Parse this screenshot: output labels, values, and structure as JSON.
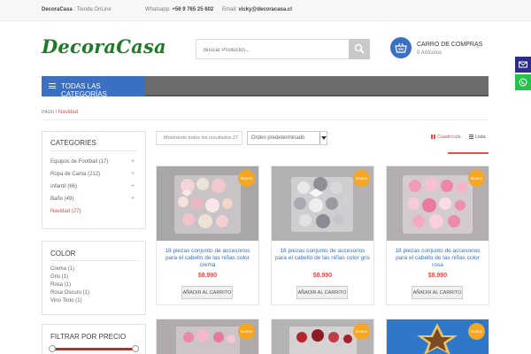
{
  "topbar": {
    "store_name": "DecoraCasa",
    "store_suffix": " : Tienda OnLine",
    "whatsapp_label": "Whatsapp: ",
    "whatsapp_number": "+56 9 765 25 602",
    "email_label": "Email: ",
    "email_value": "vicky@decoracasa.cl"
  },
  "header": {
    "logo_text": "DecoraCasa",
    "search_placeholder": "Buscar Productos...",
    "cart_title": "CARRO DE COMPRAS",
    "cart_count": "0 Artículos"
  },
  "nav": {
    "categories_button": "TODAS LAS CATEGORÍAS"
  },
  "breadcrumb": {
    "home": "Inicio",
    "separator": " / ",
    "current": "Navidad"
  },
  "sidebar": {
    "categories_title": "CATEGORIES",
    "categories": [
      {
        "label": "Equipos de Football (17)",
        "expandable": true,
        "active": false
      },
      {
        "label": "Ropa de Cama (212)",
        "expandable": true,
        "active": false
      },
      {
        "label": "Infantil (66)",
        "expandable": true,
        "active": false
      },
      {
        "label": "Baño (49)",
        "expandable": true,
        "active": false
      },
      {
        "label": "Navidad (27)",
        "expandable": false,
        "active": true
      }
    ],
    "color_title": "COLOR",
    "colors": [
      "Crema (1)",
      "Gris (1)",
      "Rosa (1)",
      "Rosa Oscuro (1)",
      "Vino Tinto (1)"
    ],
    "price_title": "FILTRAR POR PRECIO"
  },
  "toolbar": {
    "result_count": "Mostrando todos los resultados 27",
    "orderby_selected": "Orden predeterminado",
    "view_grid": "Cuadrícula",
    "view_list": "Lista"
  },
  "products": [
    {
      "badge": "Nuevo",
      "title": "18 piezas conjunto de accesorios para el cabello de las niñas color crema",
      "price": "$8.990",
      "button": "AÑADIR AL CARRITO"
    },
    {
      "badge": "Nuevo",
      "title": "18 piezas conjunto de accesorios para el cabello de las niñas color gris",
      "price": "$8.990",
      "button": "AÑADIR AL CARRITO"
    },
    {
      "badge": "Nuevo",
      "title": "18 piezas conjunto de accesorios para el cabello de las niñas color rosa",
      "price": "$8.990",
      "button": "AÑADIR AL CARRITO"
    }
  ],
  "products_row2": [
    {
      "badge": "Nuevo"
    },
    {
      "badge": "Nuevo"
    },
    {
      "badge": "Nuevo"
    }
  ],
  "colors": {
    "accent_blue": "#3b6fc3",
    "accent_red": "#d9534f",
    "logo_green": "#1f7a2a",
    "badge_orange": "#f5a623",
    "nav_gray": "#6d6d6d"
  }
}
